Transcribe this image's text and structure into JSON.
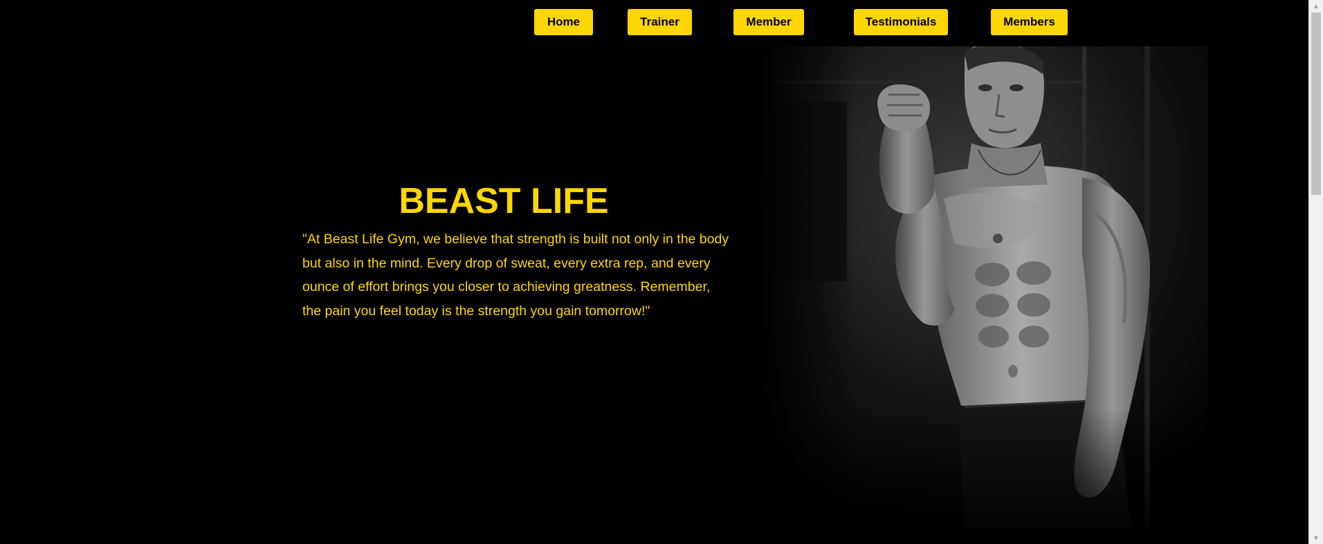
{
  "nav": {
    "items": [
      {
        "label": "Home"
      },
      {
        "label": "Trainer"
      },
      {
        "label": "Member"
      },
      {
        "label": "Testimonials"
      },
      {
        "label": "Members"
      }
    ]
  },
  "hero": {
    "title": "BEAST LIFE",
    "quote": "\"At Beast Life Gym, we believe that strength is built not only in the body but also in the mind. Every drop of sweat, every extra rep, and every ounce of effort brings you closer to achieving greatness. Remember, the pain you feel today is the strength you gain tomorrow!\"",
    "image": {
      "subject": "muscular-man-boxing-pose-photo"
    }
  },
  "colors": {
    "background": "#000000",
    "accent": "#FFD700",
    "button_text": "#000000"
  }
}
